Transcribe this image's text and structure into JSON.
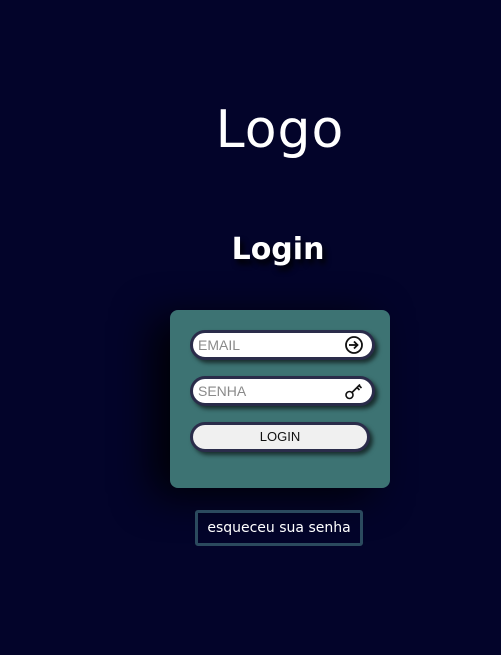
{
  "logo": {
    "text": "Logo"
  },
  "login_title": "Login",
  "form": {
    "email": {
      "placeholder": "EMAIL",
      "icon": "login-arrow-icon"
    },
    "password": {
      "placeholder": "SENHA",
      "icon": "key-icon"
    },
    "submit_label": "LOGIN"
  },
  "forgot_link": "esqueceu sua senha",
  "colors": {
    "background": "#03042a",
    "card": "#3d7373",
    "field_border": "#2a2c4a",
    "forgot_border": "#2b4a5e"
  }
}
